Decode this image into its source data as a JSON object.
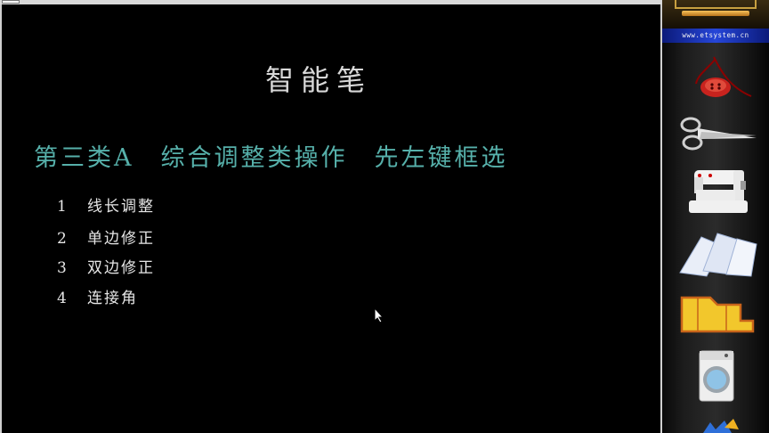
{
  "slide": {
    "title": "智能笔",
    "heading": "第三类A　综合调整类操作　先左键框选",
    "items": [
      {
        "num": "1",
        "label": "线长调整"
      },
      {
        "num": "2",
        "label": "单边修正"
      },
      {
        "num": "3",
        "label": "双边修正"
      },
      {
        "num": "4",
        "label": "连接角"
      }
    ]
  },
  "sidebar": {
    "url": "www.etsystem.cn",
    "tools": [
      "button-icon",
      "scissors-icon",
      "sewing-machine-icon",
      "fabric-pieces-icon",
      "pattern-piece-icon",
      "washing-machine-icon"
    ]
  },
  "colors": {
    "background": "#000000",
    "heading": "#56b0aa",
    "text": "#e6e6e6"
  }
}
